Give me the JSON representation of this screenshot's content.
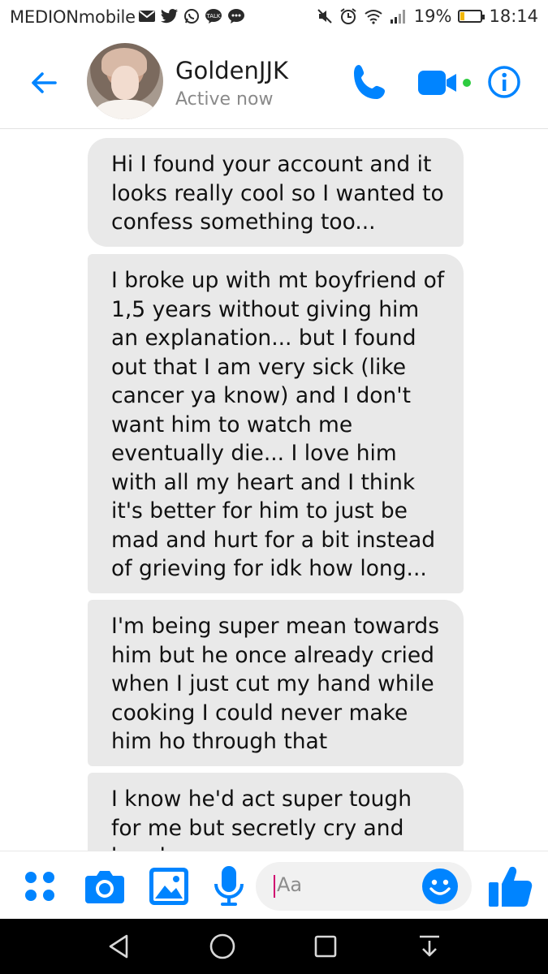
{
  "status_bar": {
    "carrier": "MEDIONmobile",
    "battery_percent": "19%",
    "battery_level": 0.19,
    "time": "18:14",
    "icons_left": [
      "mail-icon",
      "twitter-icon",
      "whatsapp-icon",
      "kakaotalk-icon",
      "chat-bubble-icon"
    ],
    "icons_right": [
      "mute-icon",
      "alarm-icon",
      "wifi-icon",
      "signal-icon",
      "battery-icon"
    ]
  },
  "header": {
    "contact_name": "GoldenJJK",
    "status": "Active now",
    "accent_color": "#0084ff",
    "online_color": "#2ecc40"
  },
  "messages": [
    {
      "text": "Hi I found your account and it looks really cool so I wanted to confess something too..."
    },
    {
      "text": "I broke up with mt boyfriend of 1,5 years without giving him an explanation... but I found out that I am very sick (like cancer ya know) and I don't want him to watch me eventually die... I love him with all my heart and I think it's better for him to just be mad and hurt for a bit instead of grieving for idk how long..."
    },
    {
      "text": "I'm being super mean towards him but he once already cried when I just cut my hand while cooking I could never make him ho through that"
    },
    {
      "text": "I know he'd act super tough for me but secretly cry and break"
    }
  ],
  "composer": {
    "placeholder": "Aa",
    "icons": [
      "apps-icon",
      "camera-icon",
      "gallery-icon",
      "microphone-icon",
      "emoji-icon",
      "thumbs-up-icon"
    ]
  },
  "navbar": {
    "icons": [
      "back-triangle-icon",
      "home-circle-icon",
      "recents-square-icon",
      "notification-pull-icon"
    ]
  }
}
